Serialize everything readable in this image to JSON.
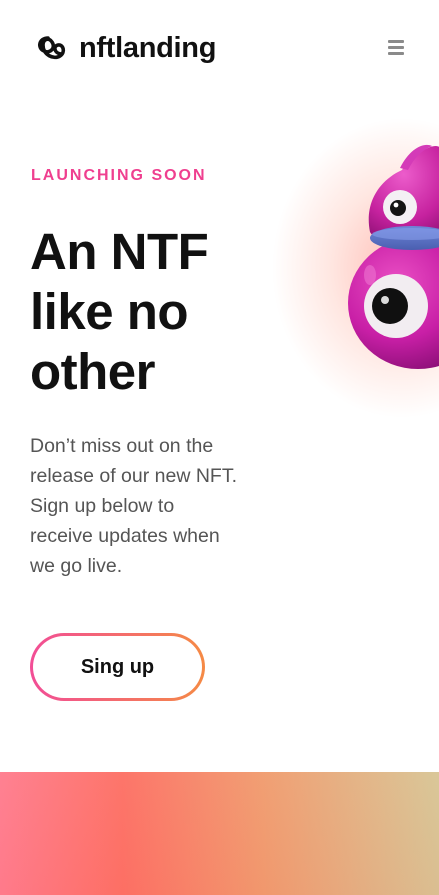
{
  "header": {
    "brand_name": "nftlanding",
    "logo_icon": "nftlanding-logo-icon",
    "menu_icon": "hamburger-menu-icon"
  },
  "hero": {
    "eyebrow": "LAUNCHING SOON",
    "headline_lines": [
      "An NTF",
      "like no",
      "other"
    ],
    "description_lines": [
      "Don’t miss out on the",
      "release of our new NFT.",
      "Sign up below to",
      "receive updates when",
      "we go live."
    ],
    "cta_label": "Sing up",
    "image": "pink-3d-creature-image"
  },
  "colors": {
    "accent_pink": "#ef3f8f",
    "accent_orange": "#f58a45",
    "text_dark": "#111111",
    "text_muted": "#555555",
    "band_start": "#ff7a8c",
    "band_end": "#d7c493"
  }
}
